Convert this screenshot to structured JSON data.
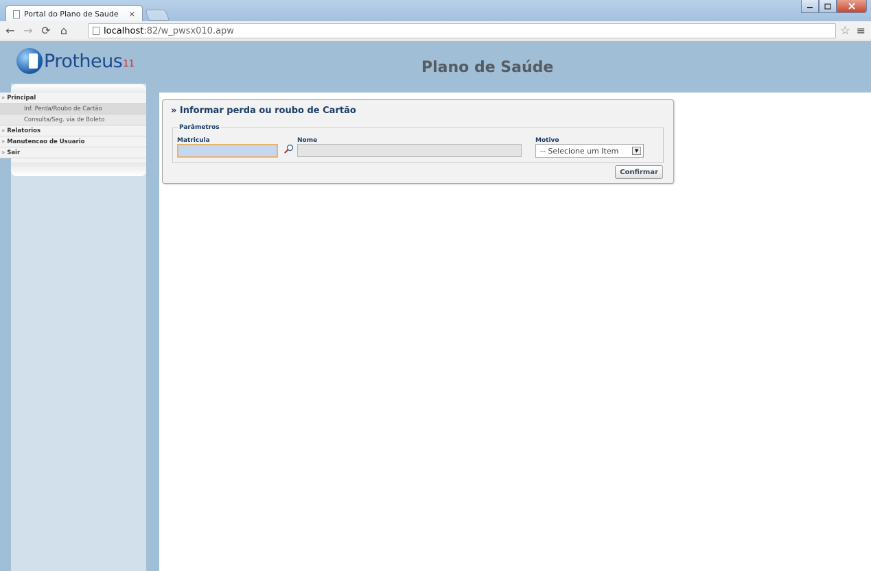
{
  "browser": {
    "tab_title": "Portal do Plano de Saude",
    "tab_close": "×",
    "url_host": "localhost",
    "url_path": ":82/w_pwsx010.apw"
  },
  "header": {
    "logo_text": "Protheus",
    "logo_version": "11",
    "title": "Plano de Saúde"
  },
  "sidebar": {
    "items": [
      {
        "type": "section",
        "label": "Principal"
      },
      {
        "type": "sub",
        "label": "Inf. Perda/Roubo de Cartão",
        "active": true
      },
      {
        "type": "sub",
        "label": "Consulta/Seg. via de Boleto"
      },
      {
        "type": "section",
        "label": "Relatorios"
      },
      {
        "type": "section",
        "label": "Manutencao de Usuario"
      },
      {
        "type": "section",
        "label": "Sair"
      }
    ]
  },
  "form": {
    "title": "» Informar perda ou roubo de Cartão",
    "legend": "Parâmetros",
    "matricula_label": "Matricula",
    "matricula_value": "",
    "nome_label": "Nome",
    "nome_value": "",
    "motivo_label": "Motivo",
    "motivo_selected": "-- Selecione um Item",
    "confirm_label": "Confirmar"
  },
  "icons": {
    "back": "arrow-left-icon",
    "forward": "arrow-right-icon",
    "reload": "reload-icon",
    "home": "home-icon",
    "page": "page-icon",
    "bookmark": "star-icon",
    "menu": "menu-icon",
    "lookup": "search-icon"
  },
  "colors": {
    "header_bg": "#a0bed5",
    "title_color": "#1b3d66",
    "sidebar_bg": "#d1e0ea"
  }
}
